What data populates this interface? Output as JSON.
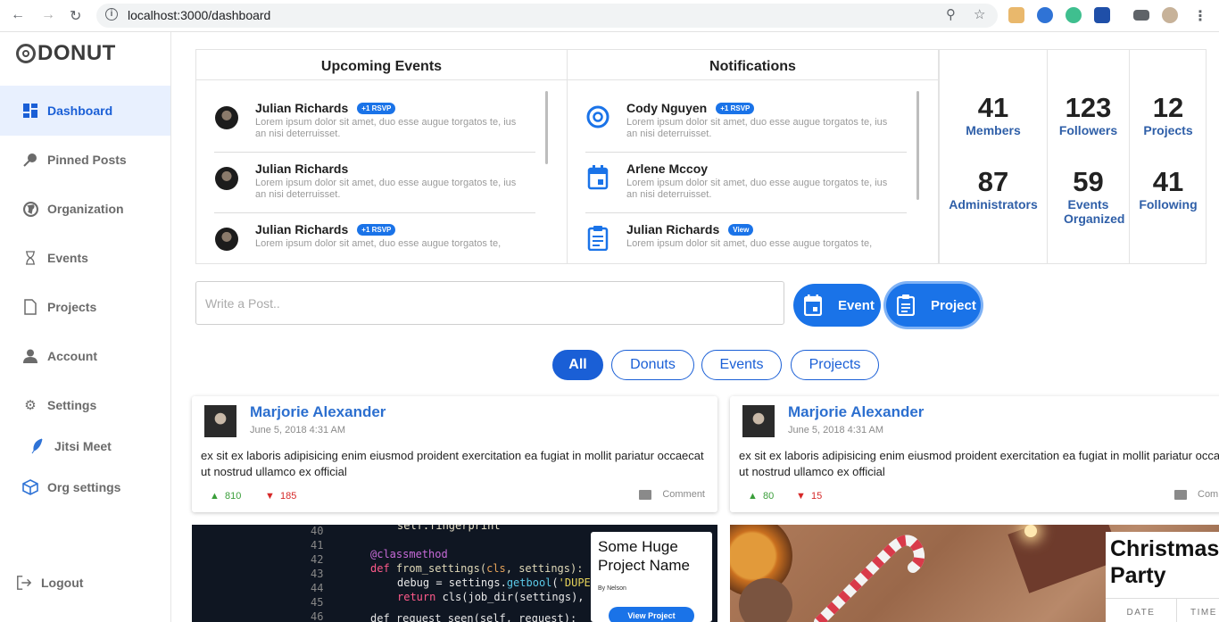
{
  "browser": {
    "url": "localhost:3000/dashboard"
  },
  "brand": {
    "name": "DONUT"
  },
  "sidebar": {
    "items": [
      {
        "label": "Dashboard",
        "icon": "dashboard-icon",
        "active": true
      },
      {
        "label": "Pinned Posts",
        "icon": "pin-icon"
      },
      {
        "label": "Organization",
        "icon": "globe-icon"
      },
      {
        "label": "Events",
        "icon": "hourglass-icon"
      },
      {
        "label": "Projects",
        "icon": "file-icon"
      },
      {
        "label": "Account",
        "icon": "person-icon"
      },
      {
        "label": "Settings",
        "icon": "gear-icon"
      },
      {
        "label": "Jitsi Meet",
        "icon": "feather-icon"
      },
      {
        "label": "Org settings",
        "icon": "cube-icon"
      }
    ],
    "logout": {
      "label": "Logout",
      "icon": "logout-icon"
    }
  },
  "upcoming_events": {
    "title": "Upcoming Events",
    "items": [
      {
        "name": "Julian Richards",
        "badge": "+1 RSVP",
        "text": "Lorem ipsum dolor sit amet, duo esse augue torgatos te, ius an nisi deterruisset."
      },
      {
        "name": "Julian Richards",
        "badge": "",
        "text": "Lorem ipsum dolor sit amet, duo esse augue torgatos te, ius an nisi deterruisset."
      },
      {
        "name": "Julian Richards",
        "badge": "+1 RSVP",
        "text": "Lorem ipsum dolor sit amet, duo esse augue torgatos te,"
      }
    ]
  },
  "notifications": {
    "title": "Notifications",
    "items": [
      {
        "name": "Cody Nguyen",
        "badge": "+1 RSVP",
        "icon": "donut-icon",
        "text": "Lorem ipsum dolor sit amet, duo esse augue torgatos te, ius an nisi deterruisset."
      },
      {
        "name": "Arlene Mccoy",
        "badge": "",
        "icon": "calendar-icon",
        "text": "Lorem ipsum dolor sit amet, duo esse augue torgatos te, ius an nisi deterruisset."
      },
      {
        "name": "Julian Richards",
        "badge": "View",
        "icon": "clipboard-icon",
        "text": "Lorem ipsum dolor sit amet, duo esse augue torgatos te,"
      }
    ]
  },
  "stats": [
    {
      "value": "41",
      "label": "Members"
    },
    {
      "value": "123",
      "label": "Followers"
    },
    {
      "value": "12",
      "label": "Projects"
    },
    {
      "value": "87",
      "label": "Administrators"
    },
    {
      "value": "59",
      "label": "Events Organized"
    },
    {
      "value": "41",
      "label": "Following"
    }
  ],
  "composer": {
    "placeholder": "Write a Post..",
    "event_label": "Event",
    "project_label": "Project"
  },
  "filters": [
    {
      "label": "All",
      "active": true
    },
    {
      "label": "Donuts"
    },
    {
      "label": "Events"
    },
    {
      "label": "Projects"
    }
  ],
  "posts": [
    {
      "author": "Marjorie Alexander",
      "date": "June 5, 2018 4:31 AM",
      "body": "ex sit ex laboris adipisicing enim eiusmod proident exercitation ea fugiat in mollit pariatur occaecat ut nostrud ullamco ex official",
      "upvotes": "810",
      "downvotes": "185",
      "comment_label": "Comment"
    },
    {
      "author": "Marjorie Alexander",
      "date": "June 5, 2018 4:31 AM",
      "body": "ex sit ex laboris adipisicing enim eiusmod proident exercitation ea fugiat in mollit pariatur occaecat ut nostrud ullamco ex official",
      "upvotes": "80",
      "downvotes": "15",
      "comment_label": "Comment"
    }
  ],
  "feature_project": {
    "title": "Some Huge Project Name",
    "by": "By Nelson",
    "button": "View Project"
  },
  "feature_event": {
    "title": "Christmas Party",
    "date_label": "DATE",
    "time_label": "TIME"
  },
  "colors": {
    "accent": "#1a73e8",
    "active_bg": "#e8f0fe",
    "stat_label": "#2f5fa8",
    "author": "#2c6fcf"
  }
}
